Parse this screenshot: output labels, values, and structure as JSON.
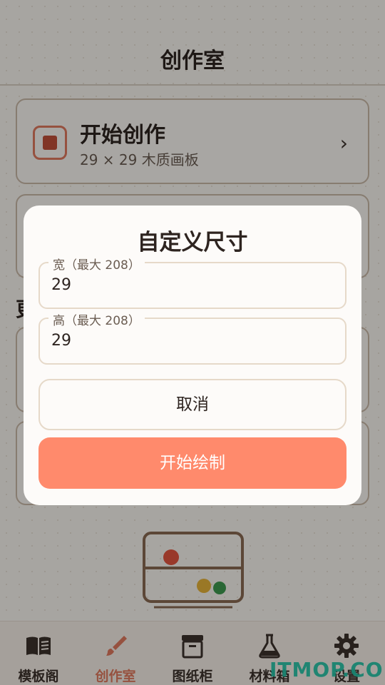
{
  "header": {
    "title": "创作室"
  },
  "start_card": {
    "title": "开始创作",
    "subtitle": "29 × 29 木质画板",
    "chevron": "›"
  },
  "section": {
    "title_partial": "更"
  },
  "dialog": {
    "title": "自定义尺寸",
    "width_field": {
      "label": "宽（最大 208）",
      "value": "29"
    },
    "height_field": {
      "label": "高（最大 208）",
      "value": "29"
    },
    "cancel_label": "取消",
    "confirm_label": "开始绘制"
  },
  "bottom_nav": {
    "items": [
      {
        "label": "模板阁",
        "icon": "book-icon"
      },
      {
        "label": "创作室",
        "icon": "brush-icon",
        "active": true
      },
      {
        "label": "图纸柜",
        "icon": "archive-icon"
      },
      {
        "label": "材料箱",
        "icon": "flask-icon"
      },
      {
        "label": "设置",
        "icon": "gear-icon"
      }
    ]
  },
  "watermark": "ITMOP.COM",
  "colors": {
    "accent": "#ff8a6c",
    "accent_dark": "#e07a5f",
    "background": "#faf6f1"
  }
}
